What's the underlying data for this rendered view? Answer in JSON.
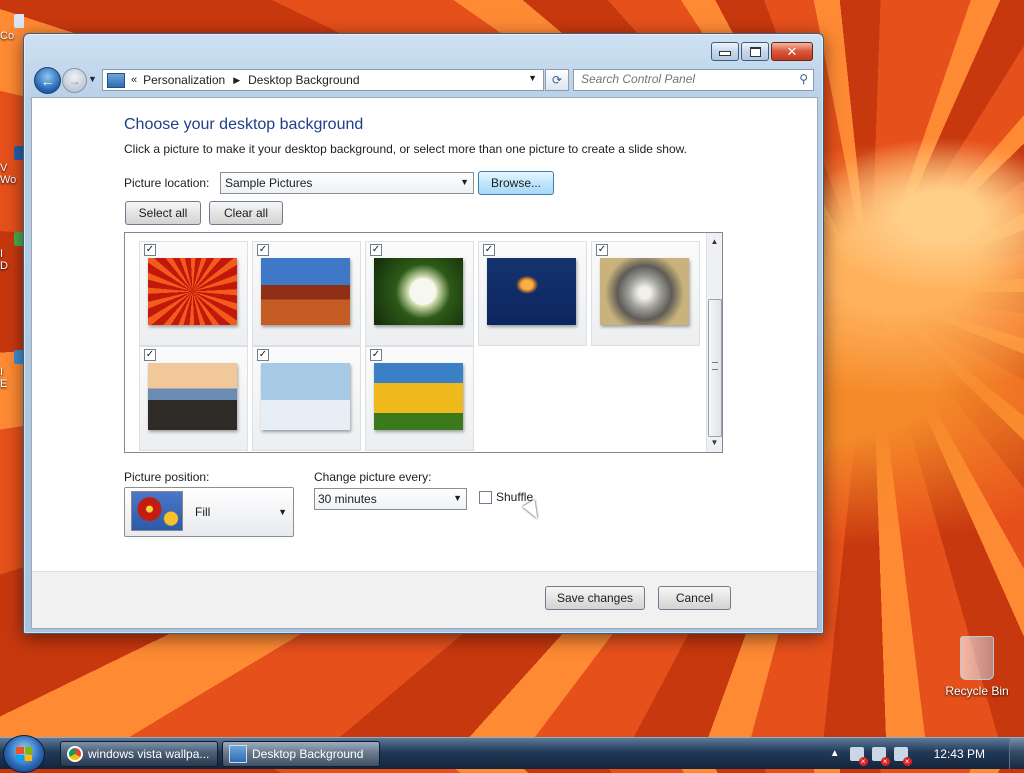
{
  "desktop": {
    "left_fragments": [
      "Co",
      "V",
      "Wo",
      "I",
      "D",
      "I",
      "E"
    ],
    "recycle_bin_label": "Recycle Bin"
  },
  "window": {
    "breadcrumb": [
      "Personalization",
      "Desktop Background"
    ],
    "breadcrumb_overflow": "«",
    "search_placeholder": "Search Control Panel",
    "heading": "Choose your desktop background",
    "description": "Click a picture to make it your desktop background, or select more than one picture to create a slide show.",
    "picture_location_label": "Picture location:",
    "picture_location_value": "Sample Pictures",
    "browse_label": "Browse...",
    "select_all_label": "Select all",
    "clear_all_label": "Clear all",
    "thumbnails": [
      {
        "icon": "chrysanthemum-picture",
        "checked": true
      },
      {
        "icon": "desert-picture",
        "checked": true
      },
      {
        "icon": "hydrangeas-picture",
        "checked": true
      },
      {
        "icon": "jellyfish-picture",
        "checked": true
      },
      {
        "icon": "koala-picture",
        "checked": true
      },
      {
        "icon": "lighthouse-picture",
        "checked": true
      },
      {
        "icon": "penguins-picture",
        "checked": true
      },
      {
        "icon": "tulips-picture",
        "checked": true
      }
    ],
    "checkmark": "✓",
    "picture_position_label": "Picture position:",
    "picture_position_value": "Fill",
    "change_picture_label": "Change picture every:",
    "change_picture_value": "30 minutes",
    "shuffle_label": "Shuffle",
    "shuffle_checked": false,
    "save_label": "Save changes",
    "cancel_label": "Cancel"
  },
  "taskbar": {
    "buttons": [
      {
        "label": "windows vista wallpa...",
        "icon": "chrome-icon"
      },
      {
        "label": "Desktop Background",
        "icon": "control-panel-icon"
      }
    ],
    "clock": "12:43 PM"
  },
  "colors": {
    "heading": "#1e3f8a",
    "accent": "#3c7fb1"
  }
}
